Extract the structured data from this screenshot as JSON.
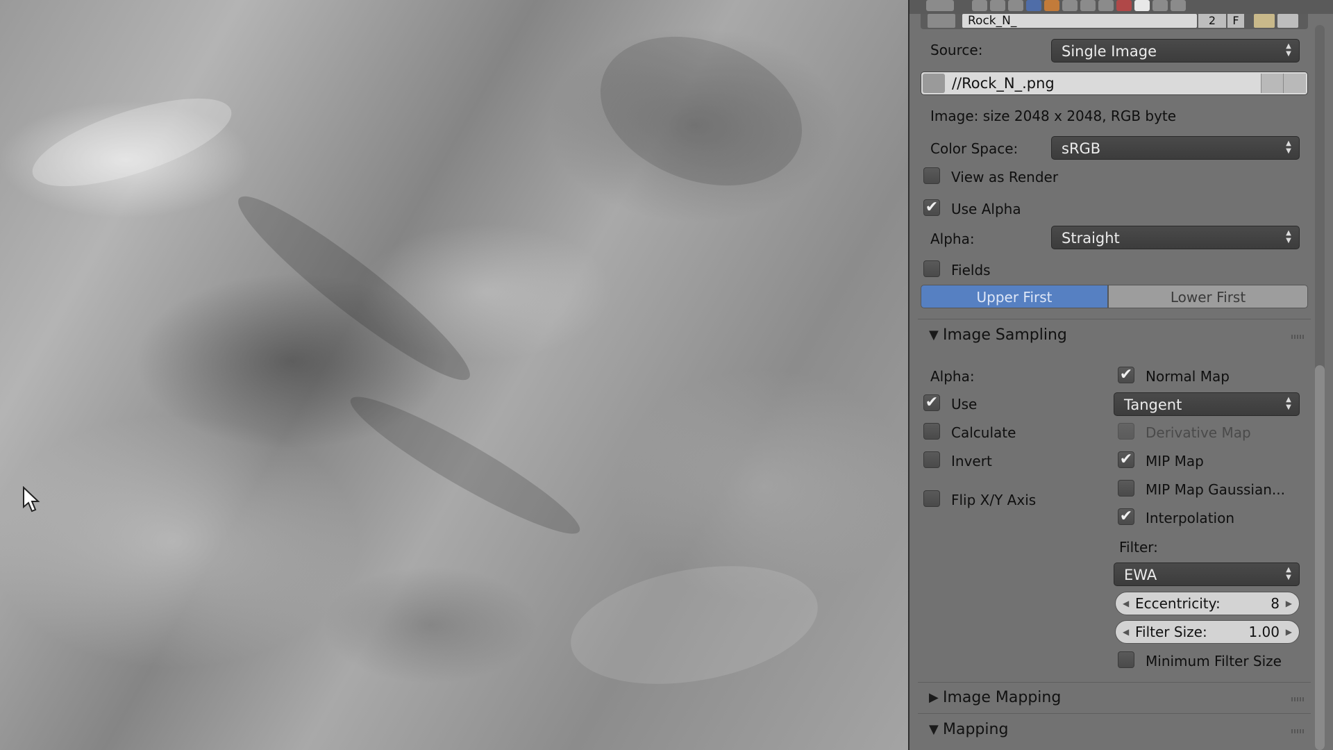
{
  "image_block": {
    "name": "Rock_N_",
    "users": "2",
    "fake_user": "F"
  },
  "source": {
    "label": "Source:",
    "value": "Single Image"
  },
  "file": {
    "path": "//Rock_N_.png"
  },
  "image_info": "Image: size 2048 x 2048, RGB byte",
  "color_space": {
    "label": "Color Space:",
    "value": "sRGB"
  },
  "view_as_render": {
    "label": "View as Render",
    "checked": false
  },
  "use_alpha": {
    "label": "Use Alpha",
    "checked": true
  },
  "alpha_mode": {
    "label": "Alpha:",
    "value": "Straight"
  },
  "fields": {
    "label": "Fields",
    "checked": false
  },
  "field_order": {
    "upper": "Upper First",
    "lower": "Lower First",
    "selected": "upper"
  },
  "sections": {
    "image_sampling": "Image Sampling",
    "image_mapping": "Image Mapping",
    "mapping": "Mapping"
  },
  "sampling": {
    "alpha_label": "Alpha:",
    "use": {
      "label": "Use",
      "checked": true
    },
    "calculate": {
      "label": "Calculate",
      "checked": false
    },
    "invert": {
      "label": "Invert",
      "checked": false
    },
    "flip_xy": {
      "label": "Flip X/Y Axis",
      "checked": false
    },
    "normal_map": {
      "label": "Normal Map",
      "checked": true
    },
    "normal_space": "Tangent",
    "derivative_map": {
      "label": "Derivative Map",
      "checked": false
    },
    "mip_map": {
      "label": "MIP Map",
      "checked": true
    },
    "mip_map_gaussian": {
      "label": "MIP Map Gaussian...",
      "checked": false
    },
    "interpolation": {
      "label": "Interpolation",
      "checked": true
    },
    "filter_label": "Filter:",
    "filter_value": "EWA",
    "eccentricity": {
      "label": "Eccentricity:",
      "value": "8"
    },
    "filter_size": {
      "label": "Filter Size:",
      "value": "1.00"
    },
    "min_filter_size": {
      "label": "Minimum Filter Size",
      "checked": false
    }
  },
  "check_glyph": "✔",
  "colors": {
    "selected_segment": "#5680c2",
    "panel_bg": "#727272"
  }
}
